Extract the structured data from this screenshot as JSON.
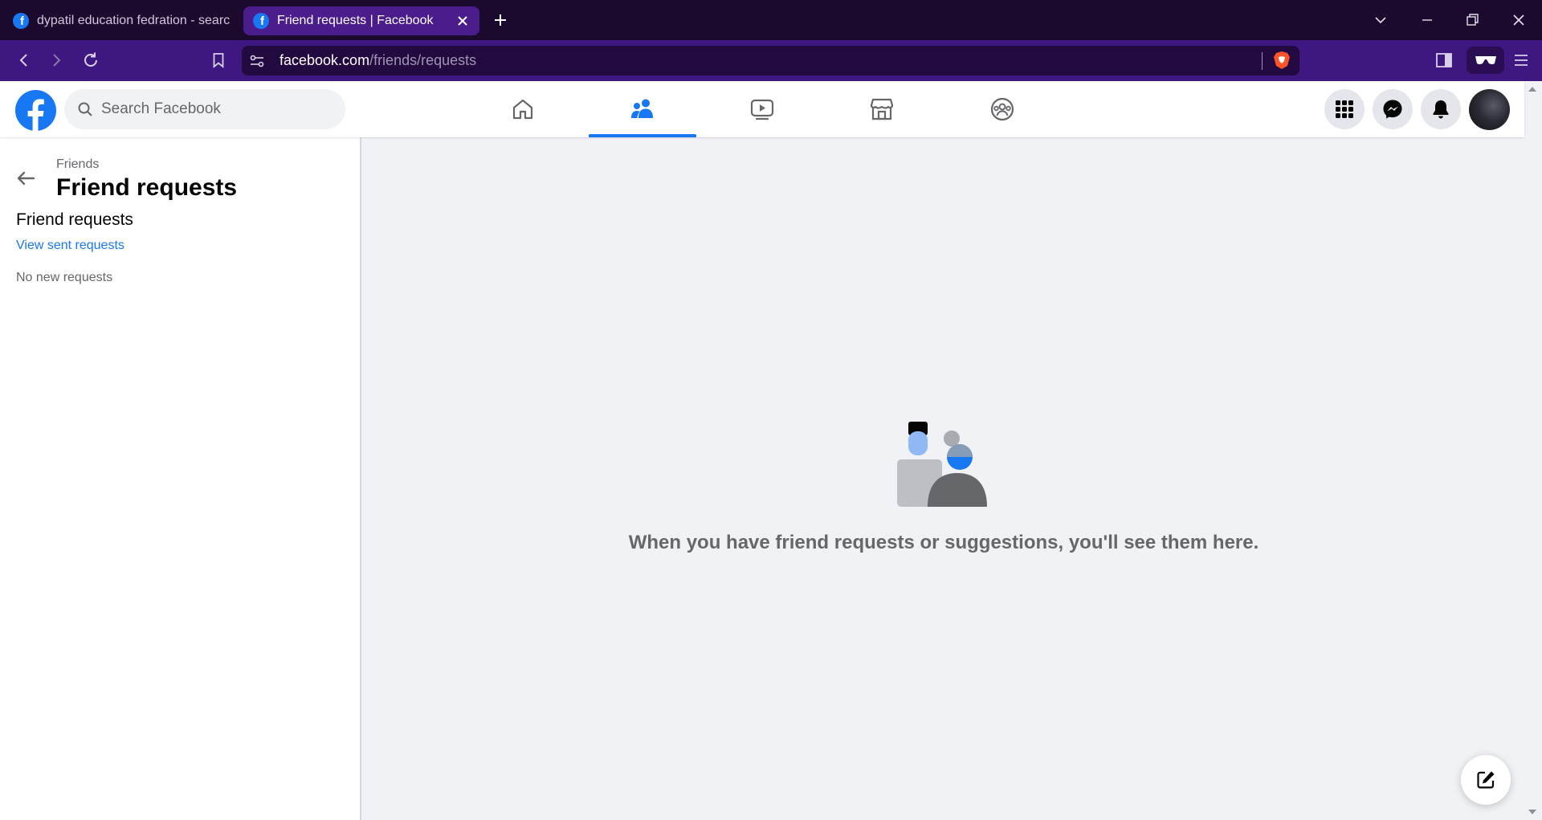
{
  "browser": {
    "tabs": [
      {
        "title": "dypatil education fedration - search",
        "active": false
      },
      {
        "title": "Friend requests | Facebook",
        "active": true
      }
    ],
    "url_domain": "facebook.com",
    "url_path": "/friends/requests"
  },
  "header": {
    "search_placeholder": "Search Facebook",
    "nav": [
      "home-icon",
      "friends-icon",
      "watch-icon",
      "marketplace-icon",
      "groups-icon"
    ],
    "active_nav": "friends",
    "actions": [
      "menu-grid-icon",
      "messenger-icon",
      "notifications-icon",
      "profile-avatar"
    ]
  },
  "sidebar": {
    "breadcrumb": "Friends",
    "title": "Friend requests",
    "section_title": "Friend requests",
    "sent_link": "View sent requests",
    "empty_text": "No new requests"
  },
  "main": {
    "empty_message": "When you have friend requests or suggestions, you'll see them here."
  },
  "colors": {
    "brand": "#1877f2",
    "tab_bar": "#1b0a2e",
    "address_bar": "#3f1781",
    "page_bg": "#f0f2f5"
  }
}
